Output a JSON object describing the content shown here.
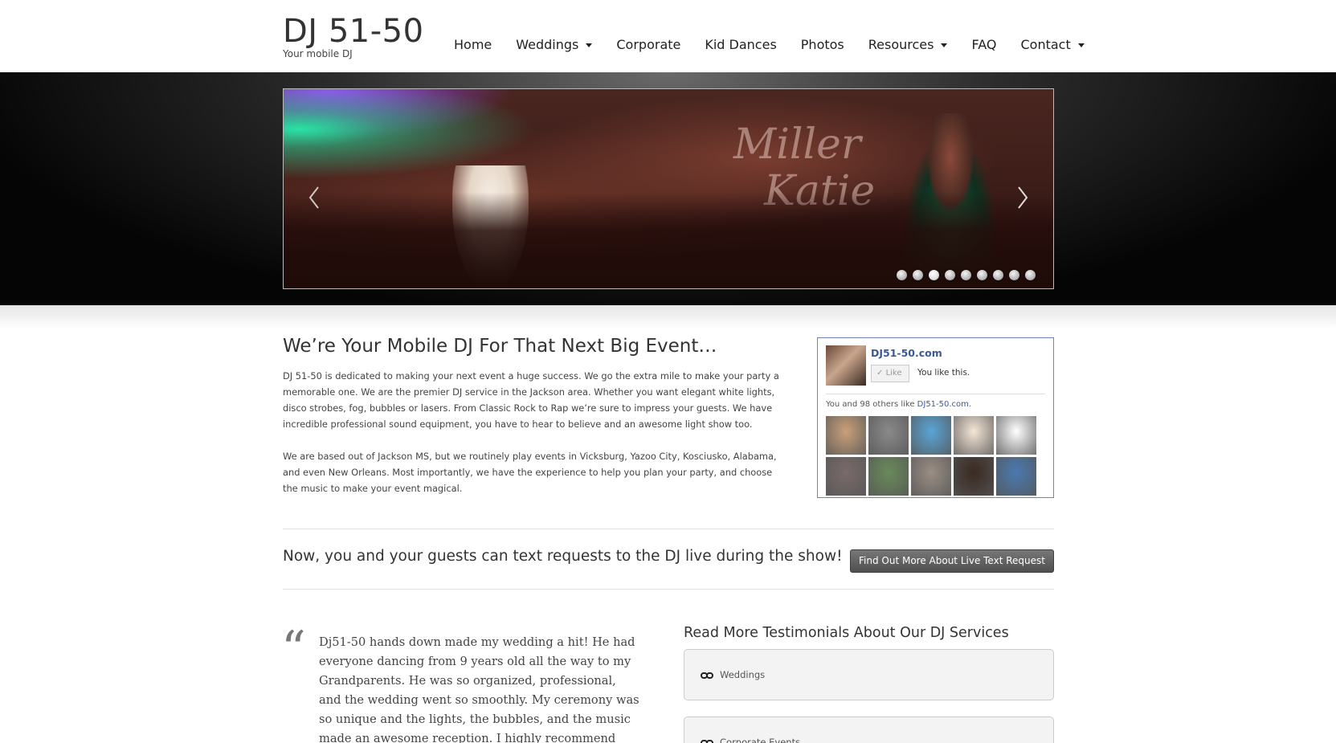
{
  "site": {
    "title": "DJ 51-50",
    "tagline": "Your mobile DJ"
  },
  "nav": [
    {
      "label": "Home",
      "dropdown": false
    },
    {
      "label": "Weddings",
      "dropdown": true
    },
    {
      "label": "Corporate",
      "dropdown": false
    },
    {
      "label": "Kid Dances",
      "dropdown": false
    },
    {
      "label": "Photos",
      "dropdown": false
    },
    {
      "label": "Resources",
      "dropdown": true
    },
    {
      "label": "FAQ",
      "dropdown": false
    },
    {
      "label": "Contact",
      "dropdown": true
    }
  ],
  "slider": {
    "monogram_line1": "Miller",
    "monogram_line2": "Katie",
    "dot_count": 9,
    "active_dot": 2
  },
  "intro": {
    "heading": "We’re Your Mobile DJ For That Next Big Event…",
    "paragraph1": "DJ 51-50 is dedicated to making your next event a huge success. We go the extra mile to make your party a memorable one. We are the premier DJ service in the Jackson area. Whether you want elegant white lights, disco strobes, fog, bubbles or lasers. From Classic Rock to Rap we’re sure to impress your guests. We have incredible professional sound equipment, you have to hear to believe and an awesome light show too.",
    "paragraph2": "We are based out of Jackson MS, but we routinely play events in Vicksburg, Yazoo City, Kosciusko, Alabama, and even New Orleans. Most importantly, we have the experience to help you plan your party, and choose the music to make your event magical."
  },
  "facebook": {
    "page_name": "DJ51-50.com",
    "like_label": "Like",
    "you_like": "You like this.",
    "count_prefix": "You and 98 others like ",
    "count_link": "DJ51-50.com",
    "count_suffix": ".",
    "faces": [
      "#c9a07a",
      "#8a8a8a",
      "#5aa5d6",
      "#f5e6d6",
      "#ffffff",
      "#7a6a6a",
      "#6a8a5a",
      "#9a8e85",
      "#3a2a22",
      "#4a7ab0"
    ]
  },
  "text_request": {
    "headline": "Now, you and your guests can text requests to the DJ live during the show!",
    "button_label": "Find Out More About Live Text Request"
  },
  "testimonial": {
    "quote_mark": "“",
    "text": "Dj51-50 hands down made my wedding a hit! He had everyone dancing from 9 years old all the way to my Grandparents. He was so organized, professional, and the wedding went so smoothly. My ceremony was so unique and the lights, the bubbles, and the music made an awesome reception. I highly recommend him to"
  },
  "testimonials_links": {
    "title": "Read More Testimonials About Our DJ Services",
    "items": [
      "Weddings",
      "Corporate Events"
    ]
  }
}
